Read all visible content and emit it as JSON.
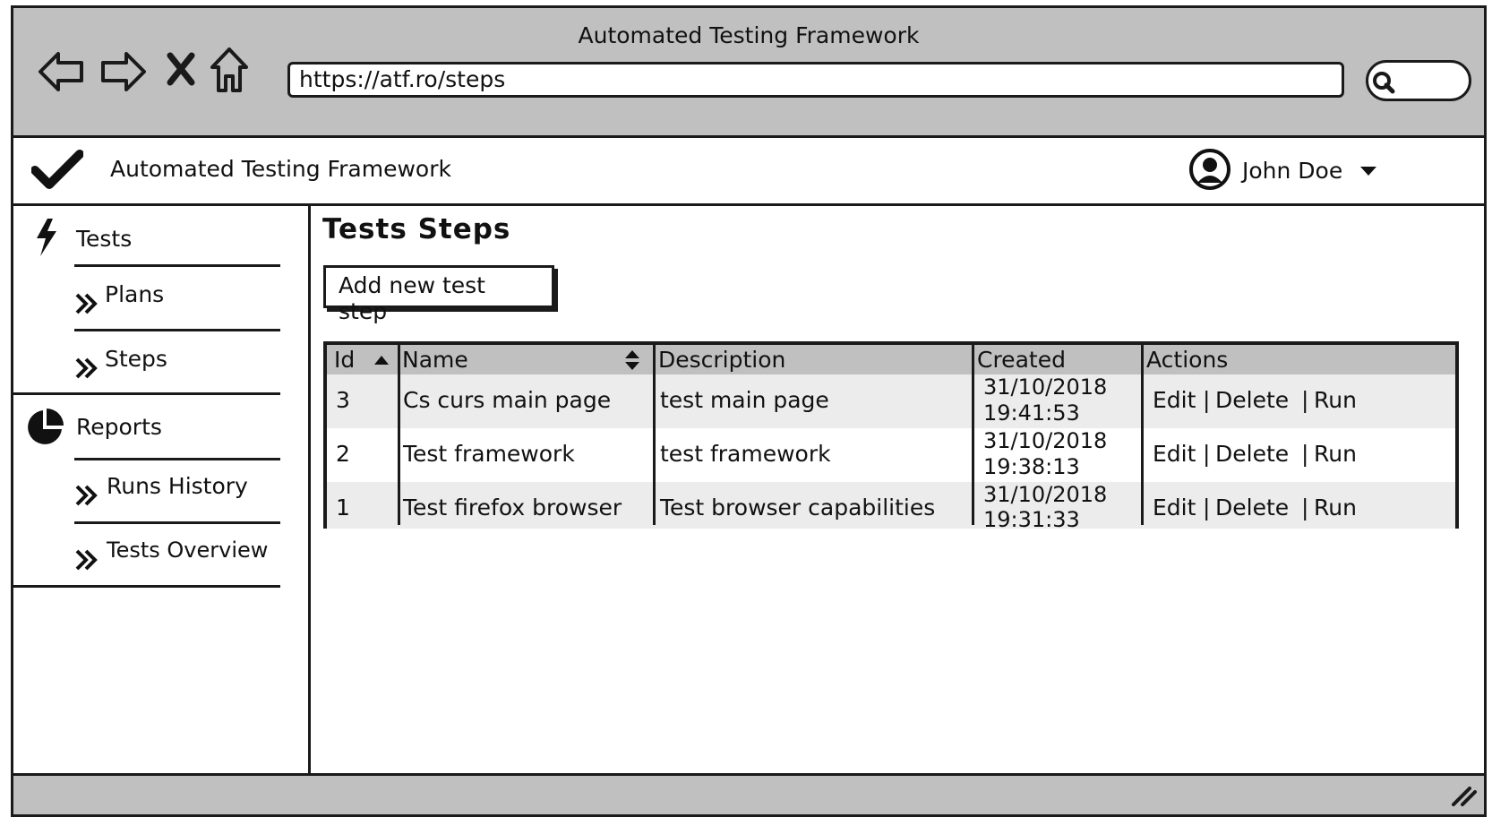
{
  "window": {
    "title": "Automated Testing Framework"
  },
  "browser": {
    "url": "https://atf.ro/steps",
    "icons": [
      "back-arrow-icon",
      "forward-arrow-icon",
      "stop-icon",
      "home-icon",
      "search-icon"
    ]
  },
  "app": {
    "title": "Automated Testing Framework",
    "user": "John Doe"
  },
  "sidebar": {
    "sections": [
      {
        "label": "Tests",
        "icon": "lightning-icon",
        "items": [
          {
            "label": "Plans"
          },
          {
            "label": "Steps"
          }
        ]
      },
      {
        "label": "Reports",
        "icon": "pie-chart-icon",
        "items": [
          {
            "label": "Runs History"
          },
          {
            "label": "Tests Overview"
          }
        ]
      }
    ]
  },
  "main": {
    "title": "Tests Steps",
    "add_button": "Add new test step",
    "table": {
      "columns": [
        "Id",
        "Name",
        "Description",
        "Created",
        "Actions"
      ],
      "rows": [
        {
          "id": "3",
          "name": "Cs curs main page",
          "description": "test main page",
          "created_date": "31/10/2018",
          "created_time": "19:41:53"
        },
        {
          "id": "2",
          "name": "Test framework",
          "description": "test framework",
          "created_date": "31/10/2018",
          "created_time": "19:38:13"
        },
        {
          "id": "1",
          "name": "Test firefox browser",
          "description": "Test browser capabilities",
          "created_date": "31/10/2018",
          "created_time": "19:31:33"
        }
      ],
      "actions": {
        "edit": "Edit",
        "delete": "Delete",
        "run": "Run",
        "separator": "|"
      }
    }
  },
  "colors": {
    "chrome": "#c0c0c0",
    "row_alt": "#ececec",
    "ink": "#1a1a1a"
  }
}
